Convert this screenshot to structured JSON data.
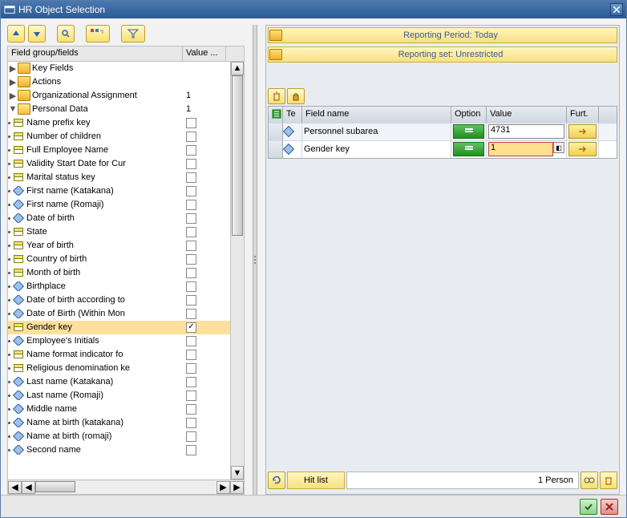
{
  "window": {
    "title": "HR Object Selection"
  },
  "tree": {
    "header": {
      "col1": "Field group/fields",
      "col2": "Value ..."
    },
    "nodes": [
      {
        "type": "folder",
        "expanded": false,
        "label": "Key Fields",
        "value": "",
        "indent": 1
      },
      {
        "type": "folder",
        "expanded": false,
        "label": "Actions",
        "value": "",
        "indent": 1
      },
      {
        "type": "folder",
        "expanded": false,
        "label": "Organizational Assignment",
        "value": "1",
        "indent": 1
      },
      {
        "type": "folder",
        "expanded": true,
        "label": "Personal Data",
        "value": "1",
        "indent": 1
      },
      {
        "type": "field",
        "icon": "table",
        "label": "Name prefix key",
        "checked": false,
        "indent": 2
      },
      {
        "type": "field",
        "icon": "table",
        "label": "Number of children",
        "checked": false,
        "indent": 2
      },
      {
        "type": "field",
        "icon": "table",
        "label": "Full Employee Name",
        "checked": false,
        "indent": 2
      },
      {
        "type": "field",
        "icon": "table",
        "label": "Validity Start Date for Cur",
        "checked": false,
        "indent": 2
      },
      {
        "type": "field",
        "icon": "table",
        "label": "Marital status key",
        "checked": false,
        "indent": 2
      },
      {
        "type": "field",
        "icon": "diamond",
        "label": "First name (Katakana)",
        "checked": false,
        "indent": 2
      },
      {
        "type": "field",
        "icon": "diamond",
        "label": "First name (Romaji)",
        "checked": false,
        "indent": 2
      },
      {
        "type": "field",
        "icon": "diamond",
        "label": "Date of birth",
        "checked": false,
        "indent": 2
      },
      {
        "type": "field",
        "icon": "table",
        "label": "State",
        "checked": false,
        "indent": 2
      },
      {
        "type": "field",
        "icon": "table",
        "label": "Year of birth",
        "checked": false,
        "indent": 2
      },
      {
        "type": "field",
        "icon": "table",
        "label": "Country of birth",
        "checked": false,
        "indent": 2
      },
      {
        "type": "field",
        "icon": "table",
        "label": "Month of birth",
        "checked": false,
        "indent": 2
      },
      {
        "type": "field",
        "icon": "diamond",
        "label": "Birthplace",
        "checked": false,
        "indent": 2
      },
      {
        "type": "field",
        "icon": "diamond",
        "label": "Date of birth according to",
        "checked": false,
        "indent": 2
      },
      {
        "type": "field",
        "icon": "diamond",
        "label": "Date of Birth (Within Mon",
        "checked": false,
        "indent": 2
      },
      {
        "type": "field",
        "icon": "table",
        "label": "Gender key",
        "checked": true,
        "indent": 2,
        "selected": true
      },
      {
        "type": "field",
        "icon": "diamond",
        "label": "Employee's Initials",
        "checked": false,
        "indent": 2
      },
      {
        "type": "field",
        "icon": "table",
        "label": "Name format indicator fo",
        "checked": false,
        "indent": 2
      },
      {
        "type": "field",
        "icon": "table",
        "label": "Religious denomination ke",
        "checked": false,
        "indent": 2
      },
      {
        "type": "field",
        "icon": "diamond",
        "label": "Last name (Katakana)",
        "checked": false,
        "indent": 2
      },
      {
        "type": "field",
        "icon": "diamond",
        "label": "Last name (Romaji)",
        "checked": false,
        "indent": 2
      },
      {
        "type": "field",
        "icon": "diamond",
        "label": "Middle name",
        "checked": false,
        "indent": 2
      },
      {
        "type": "field",
        "icon": "diamond",
        "label": "Name at birth (katakana)",
        "checked": false,
        "indent": 2
      },
      {
        "type": "field",
        "icon": "diamond",
        "label": "Name at birth (romaji)",
        "checked": false,
        "indent": 2
      },
      {
        "type": "field",
        "icon": "diamond",
        "label": "Second name",
        "checked": false,
        "indent": 2
      }
    ]
  },
  "banners": {
    "period": "Reporting Period: Today",
    "set": "Reporting set: Unrestricted"
  },
  "grid": {
    "headers": {
      "rowsel": "",
      "tech": "Te",
      "fieldname": "Field name",
      "option": "Option",
      "value": "Value",
      "further": "Furt."
    },
    "rows": [
      {
        "fieldname": "Personnel subarea",
        "option": "=",
        "value": "4731",
        "editing": false
      },
      {
        "fieldname": "Gender key",
        "option": "=",
        "value": "1",
        "editing": true
      }
    ]
  },
  "bottom": {
    "hitlist": "Hit list",
    "count": "1 Person"
  }
}
